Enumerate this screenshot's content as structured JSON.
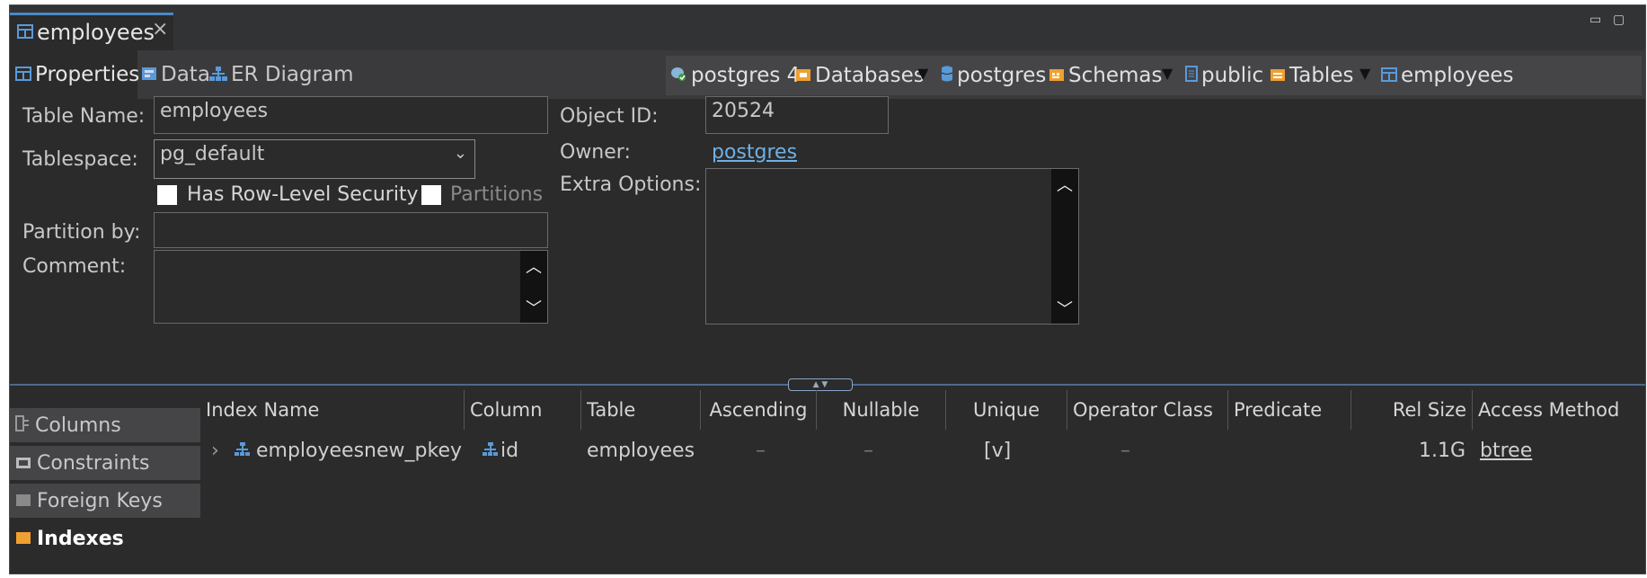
{
  "editor_tab": {
    "title": "employees",
    "close": "×"
  },
  "window_controls": {
    "minimize": "▭",
    "maximize": "▢"
  },
  "subtabs": {
    "properties": "Properties",
    "data": "Data",
    "er_diagram": "ER Diagram"
  },
  "breadcrumb": {
    "connection": "postgres 4",
    "databases": "Databases",
    "database": "postgres",
    "schemas": "Schemas",
    "schema": "public",
    "tables": "Tables",
    "table": "employees"
  },
  "form": {
    "table_name_label": "Table Name:",
    "table_name_value": "employees",
    "tablespace_label": "Tablespace:",
    "tablespace_value": "pg_default",
    "row_level_security_label": "Has Row-Level Security",
    "row_level_security_checked": false,
    "partitions_label": "Partitions",
    "partitions_checked": false,
    "partition_by_label": "Partition by:",
    "partition_by_value": "",
    "comment_label": "Comment:",
    "comment_value": "",
    "object_id_label": "Object ID:",
    "object_id_value": "20524",
    "owner_label": "Owner:",
    "owner_value": "postgres",
    "extra_options_label": "Extra Options:",
    "extra_options_value": ""
  },
  "side_tabs": [
    "Columns",
    "Constraints",
    "Foreign Keys",
    "Indexes"
  ],
  "side_tab_selected": "Indexes",
  "indexes_table": {
    "columns": [
      "Index Name",
      "Column",
      "Table",
      "Ascending",
      "Nullable",
      "Unique",
      "Operator Class",
      "Predicate",
      "Rel Size",
      "Access Method"
    ],
    "rows": [
      {
        "expander": "›",
        "index_name": "employeesnew_pkey",
        "column": "id",
        "table": "employees",
        "ascending": "–",
        "nullable": "–",
        "unique": "[v]",
        "operator_class": "–",
        "predicate": "",
        "rel_size": "1.1G",
        "access_method": "btree"
      }
    ]
  },
  "colors": {
    "background": "#2b2b2b",
    "tab_accent": "#4a88c7",
    "link": "#6eb0e6",
    "folder_icon": "#f0a030",
    "db_icon": "#5a9ad8"
  }
}
